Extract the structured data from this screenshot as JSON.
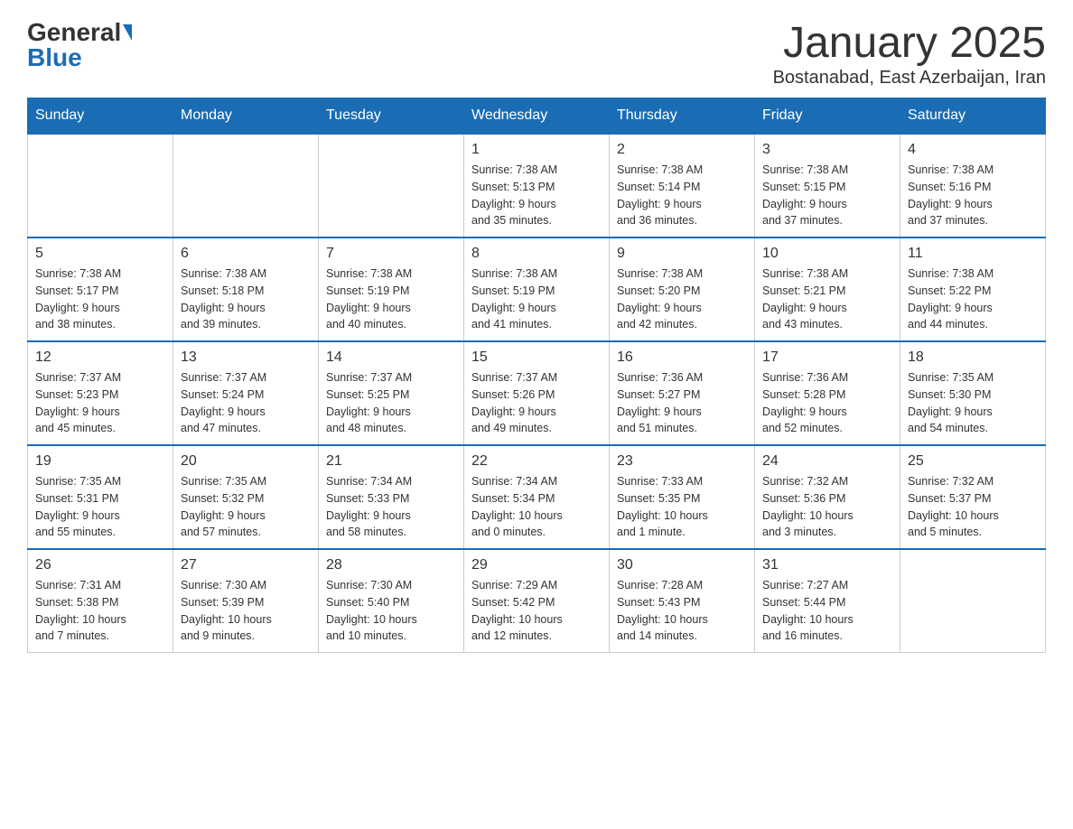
{
  "header": {
    "logo_general": "General",
    "logo_blue": "Blue",
    "month_title": "January 2025",
    "location": "Bostanabad, East Azerbaijan, Iran"
  },
  "days_of_week": [
    "Sunday",
    "Monday",
    "Tuesday",
    "Wednesday",
    "Thursday",
    "Friday",
    "Saturday"
  ],
  "weeks": [
    [
      {
        "day": "",
        "info": ""
      },
      {
        "day": "",
        "info": ""
      },
      {
        "day": "",
        "info": ""
      },
      {
        "day": "1",
        "info": "Sunrise: 7:38 AM\nSunset: 5:13 PM\nDaylight: 9 hours\nand 35 minutes."
      },
      {
        "day": "2",
        "info": "Sunrise: 7:38 AM\nSunset: 5:14 PM\nDaylight: 9 hours\nand 36 minutes."
      },
      {
        "day": "3",
        "info": "Sunrise: 7:38 AM\nSunset: 5:15 PM\nDaylight: 9 hours\nand 37 minutes."
      },
      {
        "day": "4",
        "info": "Sunrise: 7:38 AM\nSunset: 5:16 PM\nDaylight: 9 hours\nand 37 minutes."
      }
    ],
    [
      {
        "day": "5",
        "info": "Sunrise: 7:38 AM\nSunset: 5:17 PM\nDaylight: 9 hours\nand 38 minutes."
      },
      {
        "day": "6",
        "info": "Sunrise: 7:38 AM\nSunset: 5:18 PM\nDaylight: 9 hours\nand 39 minutes."
      },
      {
        "day": "7",
        "info": "Sunrise: 7:38 AM\nSunset: 5:19 PM\nDaylight: 9 hours\nand 40 minutes."
      },
      {
        "day": "8",
        "info": "Sunrise: 7:38 AM\nSunset: 5:19 PM\nDaylight: 9 hours\nand 41 minutes."
      },
      {
        "day": "9",
        "info": "Sunrise: 7:38 AM\nSunset: 5:20 PM\nDaylight: 9 hours\nand 42 minutes."
      },
      {
        "day": "10",
        "info": "Sunrise: 7:38 AM\nSunset: 5:21 PM\nDaylight: 9 hours\nand 43 minutes."
      },
      {
        "day": "11",
        "info": "Sunrise: 7:38 AM\nSunset: 5:22 PM\nDaylight: 9 hours\nand 44 minutes."
      }
    ],
    [
      {
        "day": "12",
        "info": "Sunrise: 7:37 AM\nSunset: 5:23 PM\nDaylight: 9 hours\nand 45 minutes."
      },
      {
        "day": "13",
        "info": "Sunrise: 7:37 AM\nSunset: 5:24 PM\nDaylight: 9 hours\nand 47 minutes."
      },
      {
        "day": "14",
        "info": "Sunrise: 7:37 AM\nSunset: 5:25 PM\nDaylight: 9 hours\nand 48 minutes."
      },
      {
        "day": "15",
        "info": "Sunrise: 7:37 AM\nSunset: 5:26 PM\nDaylight: 9 hours\nand 49 minutes."
      },
      {
        "day": "16",
        "info": "Sunrise: 7:36 AM\nSunset: 5:27 PM\nDaylight: 9 hours\nand 51 minutes."
      },
      {
        "day": "17",
        "info": "Sunrise: 7:36 AM\nSunset: 5:28 PM\nDaylight: 9 hours\nand 52 minutes."
      },
      {
        "day": "18",
        "info": "Sunrise: 7:35 AM\nSunset: 5:30 PM\nDaylight: 9 hours\nand 54 minutes."
      }
    ],
    [
      {
        "day": "19",
        "info": "Sunrise: 7:35 AM\nSunset: 5:31 PM\nDaylight: 9 hours\nand 55 minutes."
      },
      {
        "day": "20",
        "info": "Sunrise: 7:35 AM\nSunset: 5:32 PM\nDaylight: 9 hours\nand 57 minutes."
      },
      {
        "day": "21",
        "info": "Sunrise: 7:34 AM\nSunset: 5:33 PM\nDaylight: 9 hours\nand 58 minutes."
      },
      {
        "day": "22",
        "info": "Sunrise: 7:34 AM\nSunset: 5:34 PM\nDaylight: 10 hours\nand 0 minutes."
      },
      {
        "day": "23",
        "info": "Sunrise: 7:33 AM\nSunset: 5:35 PM\nDaylight: 10 hours\nand 1 minute."
      },
      {
        "day": "24",
        "info": "Sunrise: 7:32 AM\nSunset: 5:36 PM\nDaylight: 10 hours\nand 3 minutes."
      },
      {
        "day": "25",
        "info": "Sunrise: 7:32 AM\nSunset: 5:37 PM\nDaylight: 10 hours\nand 5 minutes."
      }
    ],
    [
      {
        "day": "26",
        "info": "Sunrise: 7:31 AM\nSunset: 5:38 PM\nDaylight: 10 hours\nand 7 minutes."
      },
      {
        "day": "27",
        "info": "Sunrise: 7:30 AM\nSunset: 5:39 PM\nDaylight: 10 hours\nand 9 minutes."
      },
      {
        "day": "28",
        "info": "Sunrise: 7:30 AM\nSunset: 5:40 PM\nDaylight: 10 hours\nand 10 minutes."
      },
      {
        "day": "29",
        "info": "Sunrise: 7:29 AM\nSunset: 5:42 PM\nDaylight: 10 hours\nand 12 minutes."
      },
      {
        "day": "30",
        "info": "Sunrise: 7:28 AM\nSunset: 5:43 PM\nDaylight: 10 hours\nand 14 minutes."
      },
      {
        "day": "31",
        "info": "Sunrise: 7:27 AM\nSunset: 5:44 PM\nDaylight: 10 hours\nand 16 minutes."
      },
      {
        "day": "",
        "info": ""
      }
    ]
  ]
}
